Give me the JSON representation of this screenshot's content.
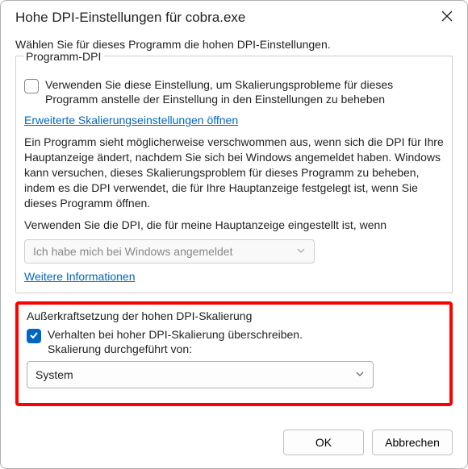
{
  "title": "Hohe DPI-Einstellungen für cobra.exe",
  "instruction": "Wählen Sie für dieses Programm die hohen DPI-Einstellungen.",
  "group1": {
    "legend": "Programm-DPI",
    "check1_label": "Verwenden Sie diese Einstellung, um Skalierungsprobleme für dieses Programm anstelle der Einstellung in den Einstellungen zu beheben",
    "link1": "Erweiterte Skalierungseinstellungen öffnen",
    "para1": "Ein Programm sieht möglicherweise verschwommen aus, wenn sich die DPI für Ihre Hauptanzeige ändert, nachdem Sie sich bei Windows angemeldet haben. Windows kann versuchen, dieses Skalierungsproblem für dieses Programm zu beheben, indem es die DPI verwendet, die für Ihre Hauptanzeige festgelegt ist, wenn Sie dieses Programm öffnen.",
    "para2": "Verwenden Sie die DPI, die für meine Hauptanzeige eingestellt ist, wenn",
    "dropdown_value": "Ich habe mich bei Windows angemeldet",
    "link2": "Weitere Informationen"
  },
  "group2": {
    "legend": "Außerkraftsetzung der hohen DPI-Skalierung",
    "check_label_line1": "Verhalten bei hoher DPI-Skalierung überschreiben.",
    "check_label_line2": "Skalierung durchgeführt von:",
    "dropdown_value": "System"
  },
  "buttons": {
    "ok": "OK",
    "cancel": "Abbrechen"
  }
}
